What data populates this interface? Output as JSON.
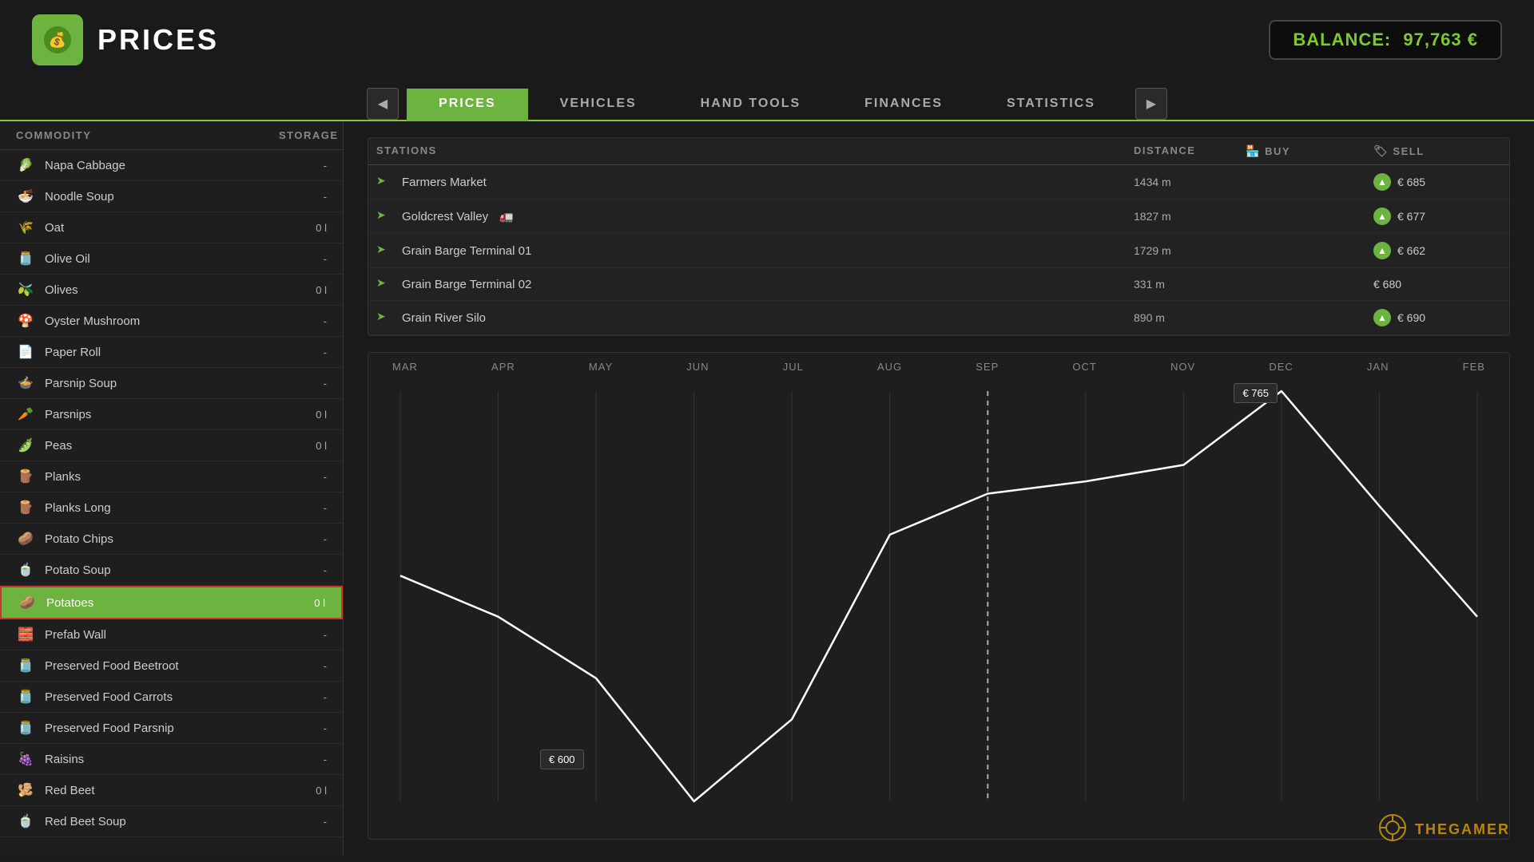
{
  "header": {
    "title": "PRICES",
    "balance_label": "BALANCE:",
    "balance_value": "97,763 €",
    "logo_icon": "💰"
  },
  "nav": {
    "prev_arrow": "◀",
    "next_arrow": "▶",
    "tabs": [
      {
        "label": "PRICES",
        "active": true
      },
      {
        "label": "VEHICLES",
        "active": false
      },
      {
        "label": "HAND TOOLS",
        "active": false
      },
      {
        "label": "FINANCES",
        "active": false
      },
      {
        "label": "STATISTICS",
        "active": false
      }
    ]
  },
  "columns": {
    "commodity": "COMMODITY",
    "storage": "STORAGE",
    "stations": "STATIONS",
    "distance": "DISTANCE",
    "buy": "BUY",
    "sell": "SELL"
  },
  "commodities": [
    {
      "name": "Napa Cabbage",
      "icon": "🥬",
      "storage": "-",
      "selected": false
    },
    {
      "name": "Noodle Soup",
      "icon": "🍜",
      "storage": "-",
      "selected": false
    },
    {
      "name": "Oat",
      "icon": "🌾",
      "storage": "0 l",
      "selected": false
    },
    {
      "name": "Olive Oil",
      "icon": "🫙",
      "storage": "-",
      "selected": false
    },
    {
      "name": "Olives",
      "icon": "🫒",
      "storage": "0 l",
      "selected": false
    },
    {
      "name": "Oyster Mushroom",
      "icon": "🍄",
      "storage": "-",
      "selected": false
    },
    {
      "name": "Paper Roll",
      "icon": "📄",
      "storage": "-",
      "selected": false
    },
    {
      "name": "Parsnip Soup",
      "icon": "🍲",
      "storage": "-",
      "selected": false
    },
    {
      "name": "Parsnips",
      "icon": "🥕",
      "storage": "0 l",
      "selected": false
    },
    {
      "name": "Peas",
      "icon": "🫛",
      "storage": "0 l",
      "selected": false
    },
    {
      "name": "Planks",
      "icon": "🪵",
      "storage": "-",
      "selected": false
    },
    {
      "name": "Planks Long",
      "icon": "🪵",
      "storage": "-",
      "selected": false
    },
    {
      "name": "Potato Chips",
      "icon": "🥔",
      "storage": "-",
      "selected": false
    },
    {
      "name": "Potato Soup",
      "icon": "🍵",
      "storage": "-",
      "selected": false
    },
    {
      "name": "Potatoes",
      "icon": "🥔",
      "storage": "0 l",
      "selected": true
    },
    {
      "name": "Prefab Wall",
      "icon": "🧱",
      "storage": "-",
      "selected": false
    },
    {
      "name": "Preserved Food Beetroot",
      "icon": "🫙",
      "storage": "-",
      "selected": false
    },
    {
      "name": "Preserved Food Carrots",
      "icon": "🫙",
      "storage": "-",
      "selected": false
    },
    {
      "name": "Preserved Food Parsnip",
      "icon": "🫙",
      "storage": "-",
      "selected": false
    },
    {
      "name": "Raisins",
      "icon": "🍇",
      "storage": "-",
      "selected": false
    },
    {
      "name": "Red Beet",
      "icon": "🫚",
      "storage": "0 l",
      "selected": false
    },
    {
      "name": "Red Beet Soup",
      "icon": "🍵",
      "storage": "-",
      "selected": false
    }
  ],
  "stations": [
    {
      "name": "Farmers Market",
      "has_truck": false,
      "distance": "1434 m",
      "buy": "",
      "sell_up": true,
      "sell": "€ 685"
    },
    {
      "name": "Goldcrest Valley",
      "has_truck": true,
      "distance": "1827 m",
      "buy": "",
      "sell_up": true,
      "sell": "€ 677"
    },
    {
      "name": "Grain Barge Terminal 01",
      "has_truck": false,
      "distance": "1729 m",
      "buy": "",
      "sell_up": true,
      "sell": "€ 662"
    },
    {
      "name": "Grain Barge Terminal 02",
      "has_truck": false,
      "distance": "331 m",
      "buy": "",
      "sell_up": false,
      "sell": "€ 680"
    },
    {
      "name": "Grain River Silo",
      "has_truck": false,
      "distance": "890 m",
      "buy": "",
      "sell_up": true,
      "sell": "€ 690"
    }
  ],
  "chart": {
    "months": [
      "MAR",
      "APR",
      "MAY",
      "JUN",
      "JUL",
      "AUG",
      "SEP",
      "OCT",
      "NOV",
      "DEC",
      "JAN",
      "FEB"
    ],
    "price_high": "€ 765",
    "price_low": "€ 600",
    "dashed_month": "SEP"
  },
  "watermark": {
    "icon": "⚙",
    "text": "THEGAMER"
  }
}
